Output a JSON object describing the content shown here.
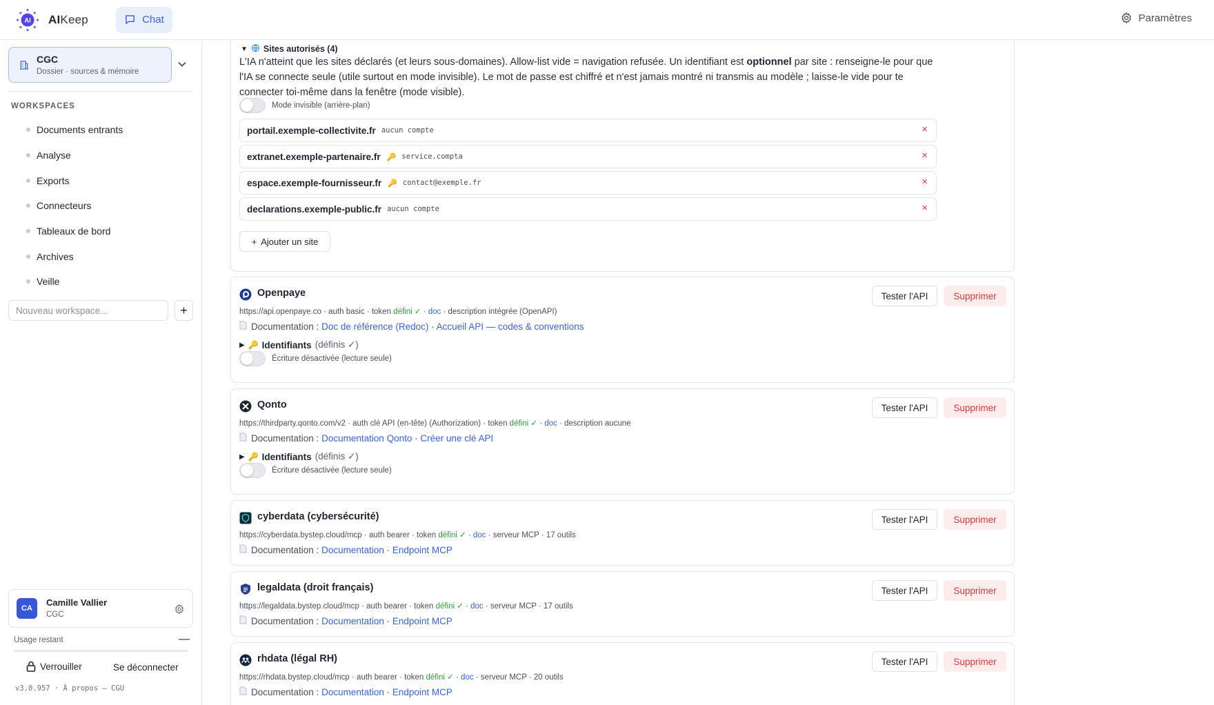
{
  "topbar": {
    "brand_prefix": "AI",
    "brand_suffix": "Keep",
    "logo_text": "AI",
    "chat_label": "Chat",
    "settings_label": "Paramètres"
  },
  "sidebar": {
    "workspace": {
      "name": "CGC",
      "subtitle": "Dossier · sources & mémoire"
    },
    "heading": "WORKSPACES",
    "items": [
      {
        "label": "Documents entrants"
      },
      {
        "label": "Analyse"
      },
      {
        "label": "Exports"
      },
      {
        "label": "Connecteurs"
      },
      {
        "label": "Tableaux de bord"
      },
      {
        "label": "Archives"
      },
      {
        "label": "Veille"
      }
    ],
    "new_placeholder": "Nouveau workspace...",
    "user": {
      "initials": "CA",
      "name": "Camille Vallier",
      "org": "CGC"
    },
    "usage_label": "Usage restant",
    "usage_value": "—",
    "lock_label": "Verrouiller",
    "logout_label": "Se déconnecter",
    "version": "v3.0.957 · À propos — CGU"
  },
  "sites": {
    "summary": "Sites autorisés (4)",
    "desc_part1": "L'IA n'atteint que les sites déclarés (et leurs sous-domaines). Allow-list vide = navigation refusée. Un identifiant est ",
    "desc_bold": "optionnel",
    "desc_part2": " par site : renseigne-le pour que l'IA se connecte seule (utile surtout en mode invisible). Le mot de passe est chiffré et n'est jamais montré ni transmis au modèle ; laisse-le vide pour te connecter toi-même dans la fenêtre (mode visible).",
    "invisible_label": "Mode invisible (arrière-plan)",
    "rows": [
      {
        "domain": "portail.exemple-collectivite.fr",
        "account": "aucun compte",
        "key": ""
      },
      {
        "domain": "extranet.exemple-partenaire.fr",
        "account": "service.compta",
        "key": "🔑"
      },
      {
        "domain": "espace.exemple-fournisseur.fr",
        "account": "contact@exemple.fr",
        "key": "🔑"
      },
      {
        "domain": "declarations.exemple-public.fr",
        "account": "aucun compte",
        "key": ""
      }
    ],
    "remove_glyph": "×",
    "add_label": "Ajouter un site"
  },
  "labels": {
    "test": "Tester l'API",
    "delete": "Supprimer",
    "doc_prefix": "Documentation :",
    "ident": "Identifiants",
    "ident_state": "(définis ✓)",
    "write_off": "Écriture désactivée (lecture seule)",
    "defined": "défini ✓",
    "doc": "doc",
    "sep": " · "
  },
  "apis": [
    {
      "name": "Openpaye",
      "icon": "openpaye-icon",
      "url": "https://api.openpaye.co",
      "auth": "auth basic",
      "token": "token",
      "desc": "description intégrée (OpenAPI)",
      "docs": [
        "Doc de référence (Redoc)",
        "Accueil API — codes & conventions"
      ]
    },
    {
      "name": "Qonto",
      "icon": "qonto-icon",
      "url": "https://thirdparty.qonto.com/v2",
      "auth": "auth clé API (en-tête) (Authorization)",
      "token": "token",
      "desc": "description aucune",
      "docs": [
        "Documentation Qonto",
        "Créer une clé API"
      ]
    },
    {
      "name": "cyberdata (cybersécurité)",
      "icon": "cyberdata-icon",
      "url": "https://cyberdata.bystep.cloud/mcp",
      "auth": "auth bearer",
      "token": "token",
      "desc": "serveur MCP · 17 outils",
      "docs": [
        "Documentation",
        "Endpoint MCP"
      ]
    },
    {
      "name": "legaldata (droit français)",
      "icon": "legaldata-icon",
      "url": "https://legaldata.bystep.cloud/mcp",
      "auth": "auth bearer",
      "token": "token",
      "desc": "serveur MCP · 17 outils",
      "docs": [
        "Documentation",
        "Endpoint MCP"
      ]
    },
    {
      "name": "rhdata (légal RH)",
      "icon": "rhdata-icon",
      "url": "https://rhdata.bystep.cloud/mcp",
      "auth": "auth bearer",
      "token": "token",
      "desc": "serveur MCP · 20 outils",
      "docs": [
        "Documentation",
        "Endpoint MCP"
      ]
    }
  ],
  "colors": {
    "accent": "#3a63d6",
    "success": "#2c9a3b",
    "danger": "#d23b3b",
    "brand": "#4f46e5"
  }
}
